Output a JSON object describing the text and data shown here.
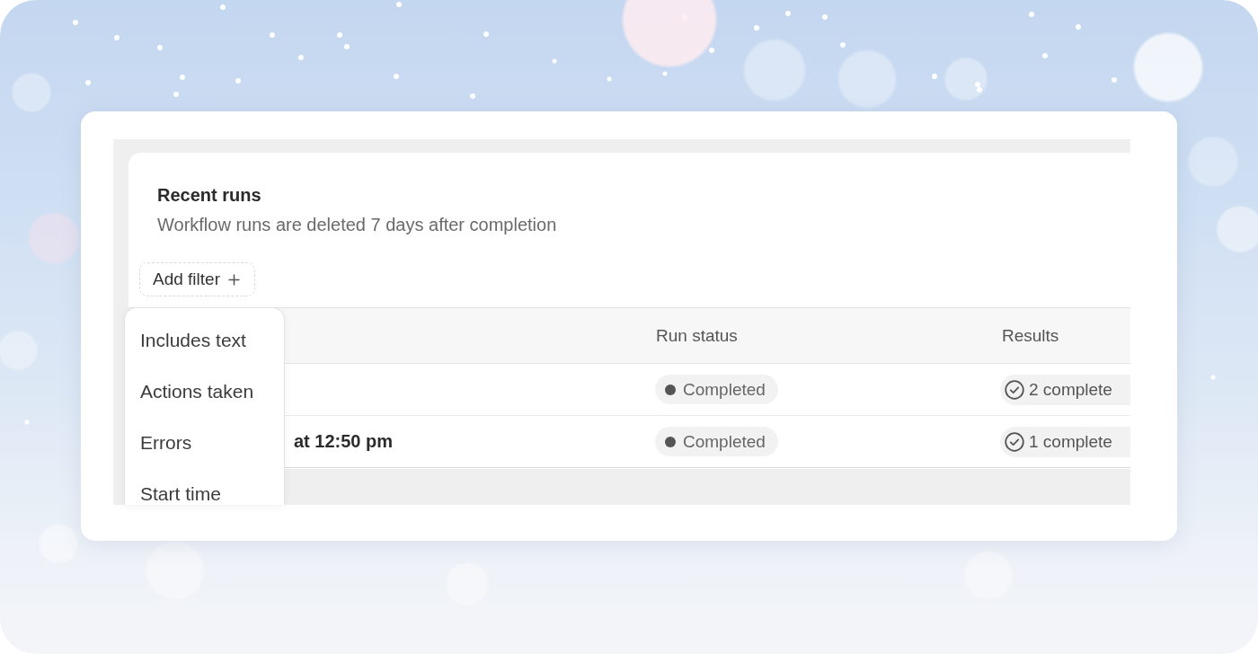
{
  "panel": {
    "title": "Recent runs",
    "subtitle": "Workflow runs are deleted 7 days after completion"
  },
  "filter_button": {
    "label": "Add filter"
  },
  "filter_menu": {
    "items": [
      "Includes text",
      "Actions taken",
      "Errors",
      "Start time"
    ]
  },
  "table": {
    "columns": [
      {
        "label": "Run status"
      },
      {
        "label": "Results"
      }
    ],
    "rows": [
      {
        "run_status": "Completed",
        "results": "2 complete"
      },
      {
        "column_1": "at 12:50 pm",
        "run_status": "Completed",
        "results": "1 complete"
      }
    ]
  }
}
